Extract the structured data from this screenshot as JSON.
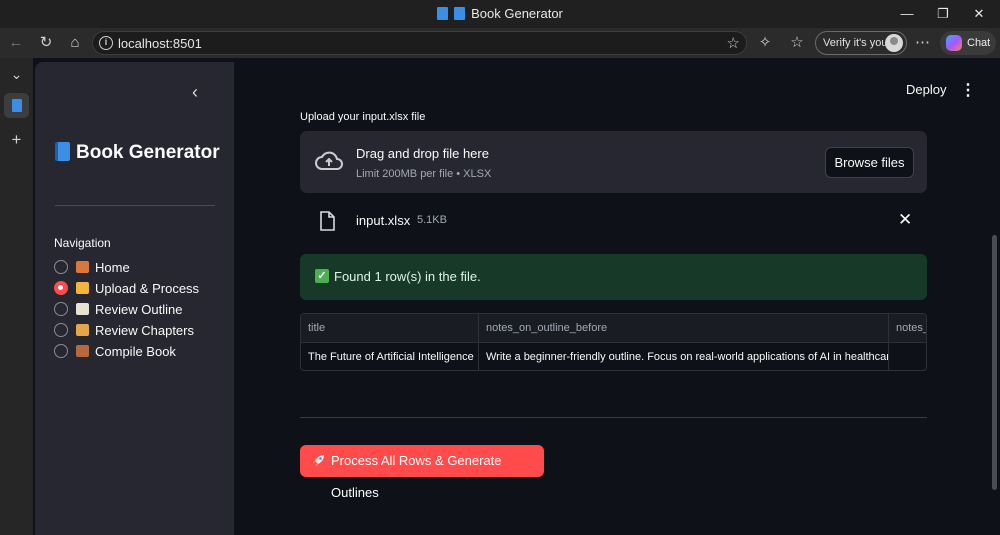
{
  "window": {
    "title": "Book Generator"
  },
  "browser": {
    "url": "localhost:8501",
    "verify_label": "Verify it's you",
    "chat_label": "Chat"
  },
  "sidebar": {
    "app_title": "Book Generator",
    "nav_label": "Navigation",
    "items": [
      {
        "label": "Home",
        "selected": false,
        "icon": "house-icon"
      },
      {
        "label": "Upload & Process",
        "selected": true,
        "icon": "folder-icon"
      },
      {
        "label": "Review Outline",
        "selected": false,
        "icon": "notepad-icon"
      },
      {
        "label": "Review Chapters",
        "selected": false,
        "icon": "writing-hand-icon"
      },
      {
        "label": "Compile Book",
        "selected": false,
        "icon": "books-icon"
      }
    ]
  },
  "header": {
    "deploy_label": "Deploy"
  },
  "uploader": {
    "label": "Upload your input.xlsx file",
    "drop_title": "Drag and drop file here",
    "drop_sub": "Limit 200MB per file • XLSX",
    "browse_label": "Browse files",
    "file_name": "input.xlsx",
    "file_size": "5.1KB"
  },
  "success": {
    "message": "Found 1 row(s) in the file."
  },
  "table": {
    "columns": [
      "title",
      "notes_on_outline_before",
      "notes_"
    ],
    "rows": [
      [
        "The Future of Artificial Intelligence",
        "Write a beginner-friendly outline. Focus on real-world applications of AI in healthcare",
        ""
      ]
    ]
  },
  "actions": {
    "process_label": "Process All Rows & Generate Outlines"
  },
  "colors": {
    "accent": "#ff4b4b",
    "success_bg": "#173928",
    "sidebar_bg": "#262730",
    "main_bg": "#0e1117"
  }
}
